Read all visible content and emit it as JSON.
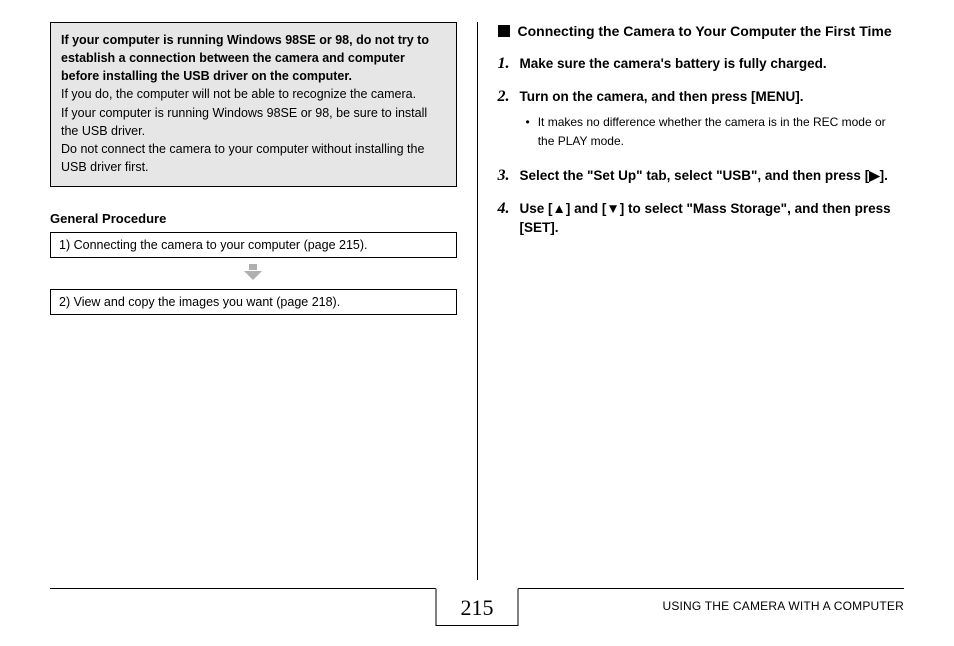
{
  "warning": {
    "bold": "If your computer is running Windows 98SE or 98, do not try to establish a connection between the camera and computer before installing the USB driver on the computer.",
    "p1": "If you do, the computer will not be able to recognize the camera.",
    "p2": "If your computer is running Windows 98SE or 98, be sure to install the USB driver.",
    "p3": "Do not connect the camera to your computer without installing the USB driver first."
  },
  "general_procedure": {
    "heading": "General Procedure",
    "step1": "1) Connecting the camera to your computer (page 215).",
    "step2": "2) View and copy the images you want (page 218)."
  },
  "section": {
    "title": "Connecting the Camera to Your Computer the First Time"
  },
  "steps": {
    "s1_num": "1.",
    "s1_text": "Make sure the camera's battery is fully charged.",
    "s2_num": "2.",
    "s2_text": "Turn on the camera, and then press [MENU].",
    "s2_bullet": "It makes no difference whether the camera is in the REC mode or the PLAY mode.",
    "s3_num": "3.",
    "s3_text": "Select the \"Set Up\" tab, select \"USB\", and then press [▶].",
    "s4_num": "4.",
    "s4_text": "Use [▲] and [▼] to select \"Mass Storage\", and then press [SET]."
  },
  "footer": {
    "page_num": "215",
    "label": "USING THE CAMERA WITH A COMPUTER"
  }
}
